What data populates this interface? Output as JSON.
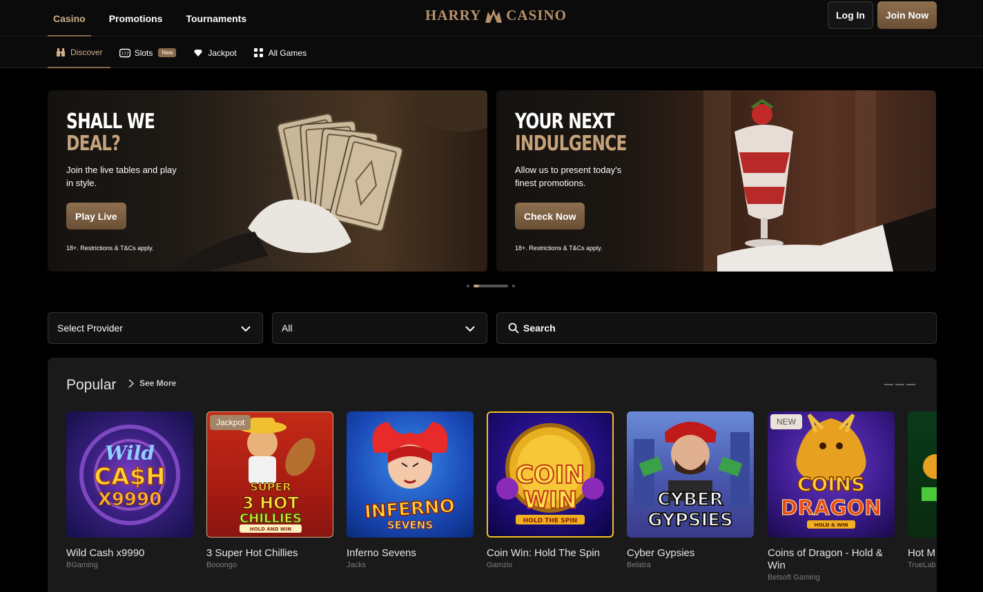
{
  "topnav": {
    "items": [
      "Casino",
      "Promotions",
      "Tournaments"
    ]
  },
  "brand": {
    "left": "HARRY",
    "right": "CASINO",
    "color": "#b8916a"
  },
  "auth": {
    "login": "Log In",
    "join": "Join Now"
  },
  "subnav": {
    "items": [
      {
        "label": "Discover",
        "icon": "binoculars-icon"
      },
      {
        "label": "Slots",
        "icon": "slot-machine-icon",
        "badge": "New"
      },
      {
        "label": "Jackpot",
        "icon": "diamond-icon"
      },
      {
        "label": "All Games",
        "icon": "grid-icon"
      }
    ]
  },
  "banners": [
    {
      "line1": "SHALL WE",
      "line2": "DEAL?",
      "desc": "Join the live tables and play in style.",
      "cta": "Play Live",
      "terms": "18+. Restrictions & T&Cs apply."
    },
    {
      "line1": "YOUR NEXT",
      "line2": "INDULGENCE",
      "desc": "Allow us to present today's finest promotions.",
      "cta": "Check Now",
      "terms": "18+. Restrictions & T&Cs apply."
    }
  ],
  "carousel": {
    "slides": 3,
    "active": 1
  },
  "filters": {
    "provider": "Select Provider",
    "category": "All",
    "search": "Search"
  },
  "popular": {
    "title": "Popular",
    "see_more": "See More",
    "games": [
      {
        "name": "Wild Cash x9990",
        "provider": "BGaming",
        "tag": "",
        "art": "Wild CA$H x9990"
      },
      {
        "name": "3 Super Hot Chillies",
        "provider": "Booongo",
        "tag": "Jackpot",
        "art": "3 SUPER HOT CHILLIES"
      },
      {
        "name": "Inferno Sevens",
        "provider": "Jacks",
        "tag": "",
        "art": "INFERNO SEVENS"
      },
      {
        "name": "Coin Win: Hold The Spin",
        "provider": "Gamzix",
        "tag": "",
        "art": "COIN WIN"
      },
      {
        "name": "Cyber Gypsies",
        "provider": "Belatra",
        "tag": "",
        "art": "CYBER GYPSIES"
      },
      {
        "name": "Coins of Dragon - Hold & Win",
        "provider": "Betsoft Gaming",
        "tag": "NEW",
        "art": "COINS DRAGON"
      },
      {
        "name": "Hot M",
        "provider": "TrueLab",
        "tag": "",
        "art": ""
      }
    ]
  }
}
